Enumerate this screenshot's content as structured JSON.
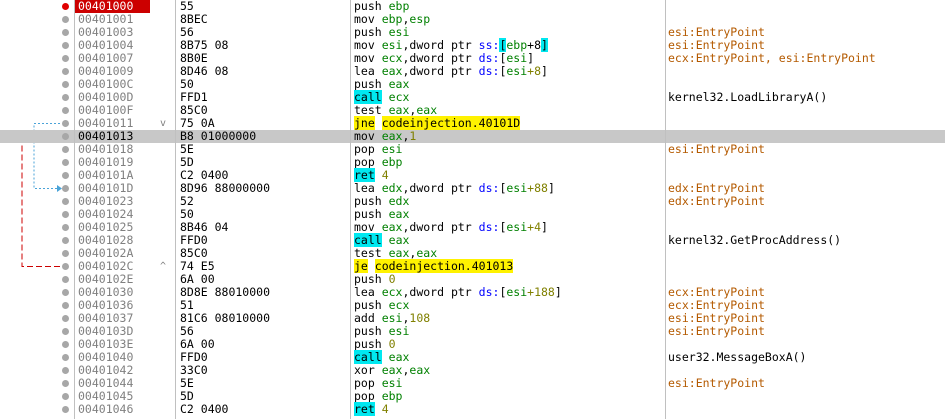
{
  "rows": [
    {
      "addr": "00401000",
      "bytes": "55",
      "comment": "",
      "bp": "active",
      "eip": true
    },
    {
      "addr": "00401001",
      "bytes": "8BEC",
      "comment": ""
    },
    {
      "addr": "00401003",
      "bytes": "56",
      "comment": "esi:EntryPoint"
    },
    {
      "addr": "00401004",
      "bytes": "8B75 08",
      "comment": "esi:EntryPoint"
    },
    {
      "addr": "00401007",
      "bytes": "8B0E",
      "comment": "ecx:EntryPoint, esi:EntryPoint"
    },
    {
      "addr": "00401009",
      "bytes": "8D46 08",
      "comment": ""
    },
    {
      "addr": "0040100C",
      "bytes": "50",
      "comment": ""
    },
    {
      "addr": "0040100D",
      "bytes": "FFD1",
      "comment": "kernel32.LoadLibraryA()"
    },
    {
      "addr": "0040100F",
      "bytes": "85C0",
      "comment": ""
    },
    {
      "addr": "00401011",
      "bytes": "75 0A",
      "mark": "v",
      "comment": ""
    },
    {
      "addr": "00401013",
      "bytes": "B8 01000000",
      "comment": "",
      "selected": true
    },
    {
      "addr": "00401018",
      "bytes": "5E",
      "comment": "esi:EntryPoint"
    },
    {
      "addr": "00401019",
      "bytes": "5D",
      "comment": ""
    },
    {
      "addr": "0040101A",
      "bytes": "C2 0400",
      "comment": ""
    },
    {
      "addr": "0040101D",
      "bytes": "8D96 88000000",
      "comment": "edx:EntryPoint"
    },
    {
      "addr": "00401023",
      "bytes": "52",
      "comment": "edx:EntryPoint"
    },
    {
      "addr": "00401024",
      "bytes": "50",
      "comment": ""
    },
    {
      "addr": "00401025",
      "bytes": "8B46 04",
      "comment": ""
    },
    {
      "addr": "00401028",
      "bytes": "FFD0",
      "comment": "kernel32.GetProcAddress()"
    },
    {
      "addr": "0040102A",
      "bytes": "85C0",
      "comment": ""
    },
    {
      "addr": "0040102C",
      "bytes": "74 E5",
      "mark": "^",
      "comment": ""
    },
    {
      "addr": "0040102E",
      "bytes": "6A 00",
      "comment": ""
    },
    {
      "addr": "00401030",
      "bytes": "8D8E 88010000",
      "comment": "ecx:EntryPoint"
    },
    {
      "addr": "00401036",
      "bytes": "51",
      "comment": "ecx:EntryPoint"
    },
    {
      "addr": "00401037",
      "bytes": "81C6 08010000",
      "comment": "esi:EntryPoint"
    },
    {
      "addr": "0040103D",
      "bytes": "56",
      "comment": "esi:EntryPoint"
    },
    {
      "addr": "0040103E",
      "bytes": "6A 00",
      "comment": ""
    },
    {
      "addr": "00401040",
      "bytes": "FFD0",
      "comment": "user32.MessageBoxA()"
    },
    {
      "addr": "00401042",
      "bytes": "33C0",
      "comment": ""
    },
    {
      "addr": "00401044",
      "bytes": "5E",
      "comment": "esi:EntryPoint"
    },
    {
      "addr": "00401045",
      "bytes": "5D",
      "comment": ""
    },
    {
      "addr": "00401046",
      "bytes": "C2 0400",
      "comment": ""
    }
  ],
  "instructions": [
    [
      [
        "push ",
        "mn"
      ],
      [
        "ebp",
        "reg"
      ]
    ],
    [
      [
        "mov ",
        "mn"
      ],
      [
        "ebp",
        "reg"
      ],
      [
        ",",
        ""
      ],
      [
        "esp",
        "reg"
      ]
    ],
    [
      [
        "push ",
        "mn"
      ],
      [
        "esi",
        "reg"
      ]
    ],
    [
      [
        "mov ",
        "mn"
      ],
      [
        "esi",
        "reg"
      ],
      [
        ",dword ptr ",
        ""
      ],
      [
        "ss:",
        "seg"
      ],
      [
        "[",
        "br"
      ],
      [
        "ebp",
        "reg"
      ],
      [
        "+8",
        ""
      ],
      [
        "]",
        "br"
      ]
    ],
    [
      [
        "mov ",
        "mn"
      ],
      [
        "ecx",
        "reg"
      ],
      [
        ",dword ptr ",
        ""
      ],
      [
        "ds:",
        "seg"
      ],
      [
        "[",
        ""
      ],
      [
        "esi",
        "reg"
      ],
      [
        "]",
        ""
      ]
    ],
    [
      [
        "lea ",
        "mn"
      ],
      [
        "eax",
        "reg"
      ],
      [
        ",dword ptr ",
        ""
      ],
      [
        "ds:",
        "seg"
      ],
      [
        "[",
        ""
      ],
      [
        "esi",
        "reg"
      ],
      [
        "+8",
        "num"
      ],
      [
        "]",
        ""
      ]
    ],
    [
      [
        "push ",
        "mn"
      ],
      [
        "eax",
        "reg"
      ]
    ],
    [
      [
        "call",
        "call"
      ],
      [
        " ",
        ""
      ],
      [
        "ecx",
        "reg"
      ]
    ],
    [
      [
        "test ",
        "mn"
      ],
      [
        "eax",
        "reg"
      ],
      [
        ",",
        ""
      ],
      [
        "eax",
        "reg"
      ]
    ],
    [
      [
        "jne",
        "jmp"
      ],
      [
        " ",
        ""
      ],
      [
        "codeinjection.40101D",
        "jmp"
      ]
    ],
    [
      [
        "mov ",
        "mn"
      ],
      [
        "eax",
        "reg"
      ],
      [
        ",",
        ""
      ],
      [
        "1",
        "num"
      ]
    ],
    [
      [
        "pop ",
        "mn"
      ],
      [
        "esi",
        "reg"
      ]
    ],
    [
      [
        "pop ",
        "mn"
      ],
      [
        "ebp",
        "reg"
      ]
    ],
    [
      [
        "ret",
        "call"
      ],
      [
        " ",
        ""
      ],
      [
        "4",
        "num"
      ]
    ],
    [
      [
        "lea ",
        "mn"
      ],
      [
        "edx",
        "reg"
      ],
      [
        ",dword ptr ",
        ""
      ],
      [
        "ds:",
        "seg"
      ],
      [
        "[",
        ""
      ],
      [
        "esi",
        "reg"
      ],
      [
        "+88",
        "num"
      ],
      [
        "]",
        ""
      ]
    ],
    [
      [
        "push ",
        "mn"
      ],
      [
        "edx",
        "reg"
      ]
    ],
    [
      [
        "push ",
        "mn"
      ],
      [
        "eax",
        "reg"
      ]
    ],
    [
      [
        "mov ",
        "mn"
      ],
      [
        "eax",
        "reg"
      ],
      [
        ",dword ptr ",
        ""
      ],
      [
        "ds:",
        "seg"
      ],
      [
        "[",
        ""
      ],
      [
        "esi",
        "reg"
      ],
      [
        "+4",
        "num"
      ],
      [
        "]",
        ""
      ]
    ],
    [
      [
        "call",
        "call"
      ],
      [
        " ",
        ""
      ],
      [
        "eax",
        "reg"
      ]
    ],
    [
      [
        "test ",
        "mn"
      ],
      [
        "eax",
        "reg"
      ],
      [
        ",",
        ""
      ],
      [
        "eax",
        "reg"
      ]
    ],
    [
      [
        "je",
        "jmp"
      ],
      [
        " ",
        ""
      ],
      [
        "codeinjection.401013",
        "jmp"
      ]
    ],
    [
      [
        "push ",
        "mn"
      ],
      [
        "0",
        "num"
      ]
    ],
    [
      [
        "lea ",
        "mn"
      ],
      [
        "ecx",
        "reg"
      ],
      [
        ",dword ptr ",
        ""
      ],
      [
        "ds:",
        "seg"
      ],
      [
        "[",
        ""
      ],
      [
        "esi",
        "reg"
      ],
      [
        "+188",
        "num"
      ],
      [
        "]",
        ""
      ]
    ],
    [
      [
        "push ",
        "mn"
      ],
      [
        "ecx",
        "reg"
      ]
    ],
    [
      [
        "add ",
        "mn"
      ],
      [
        "esi",
        "reg"
      ],
      [
        ",",
        ""
      ],
      [
        "108",
        "num"
      ]
    ],
    [
      [
        "push ",
        "mn"
      ],
      [
        "esi",
        "reg"
      ]
    ],
    [
      [
        "push ",
        "mn"
      ],
      [
        "0",
        "num"
      ]
    ],
    [
      [
        "call",
        "call"
      ],
      [
        " ",
        ""
      ],
      [
        "eax",
        "reg"
      ]
    ],
    [
      [
        "xor ",
        "mn"
      ],
      [
        "eax",
        "reg"
      ],
      [
        ",",
        ""
      ],
      [
        "eax",
        "reg"
      ]
    ],
    [
      [
        "pop ",
        "mn"
      ],
      [
        "esi",
        "reg"
      ]
    ],
    [
      [
        "pop ",
        "mn"
      ],
      [
        "ebp",
        "reg"
      ]
    ],
    [
      [
        "ret",
        "call"
      ],
      [
        " ",
        ""
      ],
      [
        "4",
        "num"
      ]
    ]
  ],
  "colors": {
    "eip_bg": "#cc0000",
    "selected_row": "#c8c8c8",
    "call_ret_bg": "#00e8f0",
    "jump_bg": "#fff200",
    "register": "#008000",
    "number": "#808000",
    "segment": "#0000ff",
    "symbol_comment": "#b45a00",
    "breakpoint_active": "#e00000",
    "breakpoint_idle": "#a7a7a7",
    "jump_arrow_taken": "#cc0000",
    "jump_arrow_not_taken": "#4aa3d8"
  }
}
